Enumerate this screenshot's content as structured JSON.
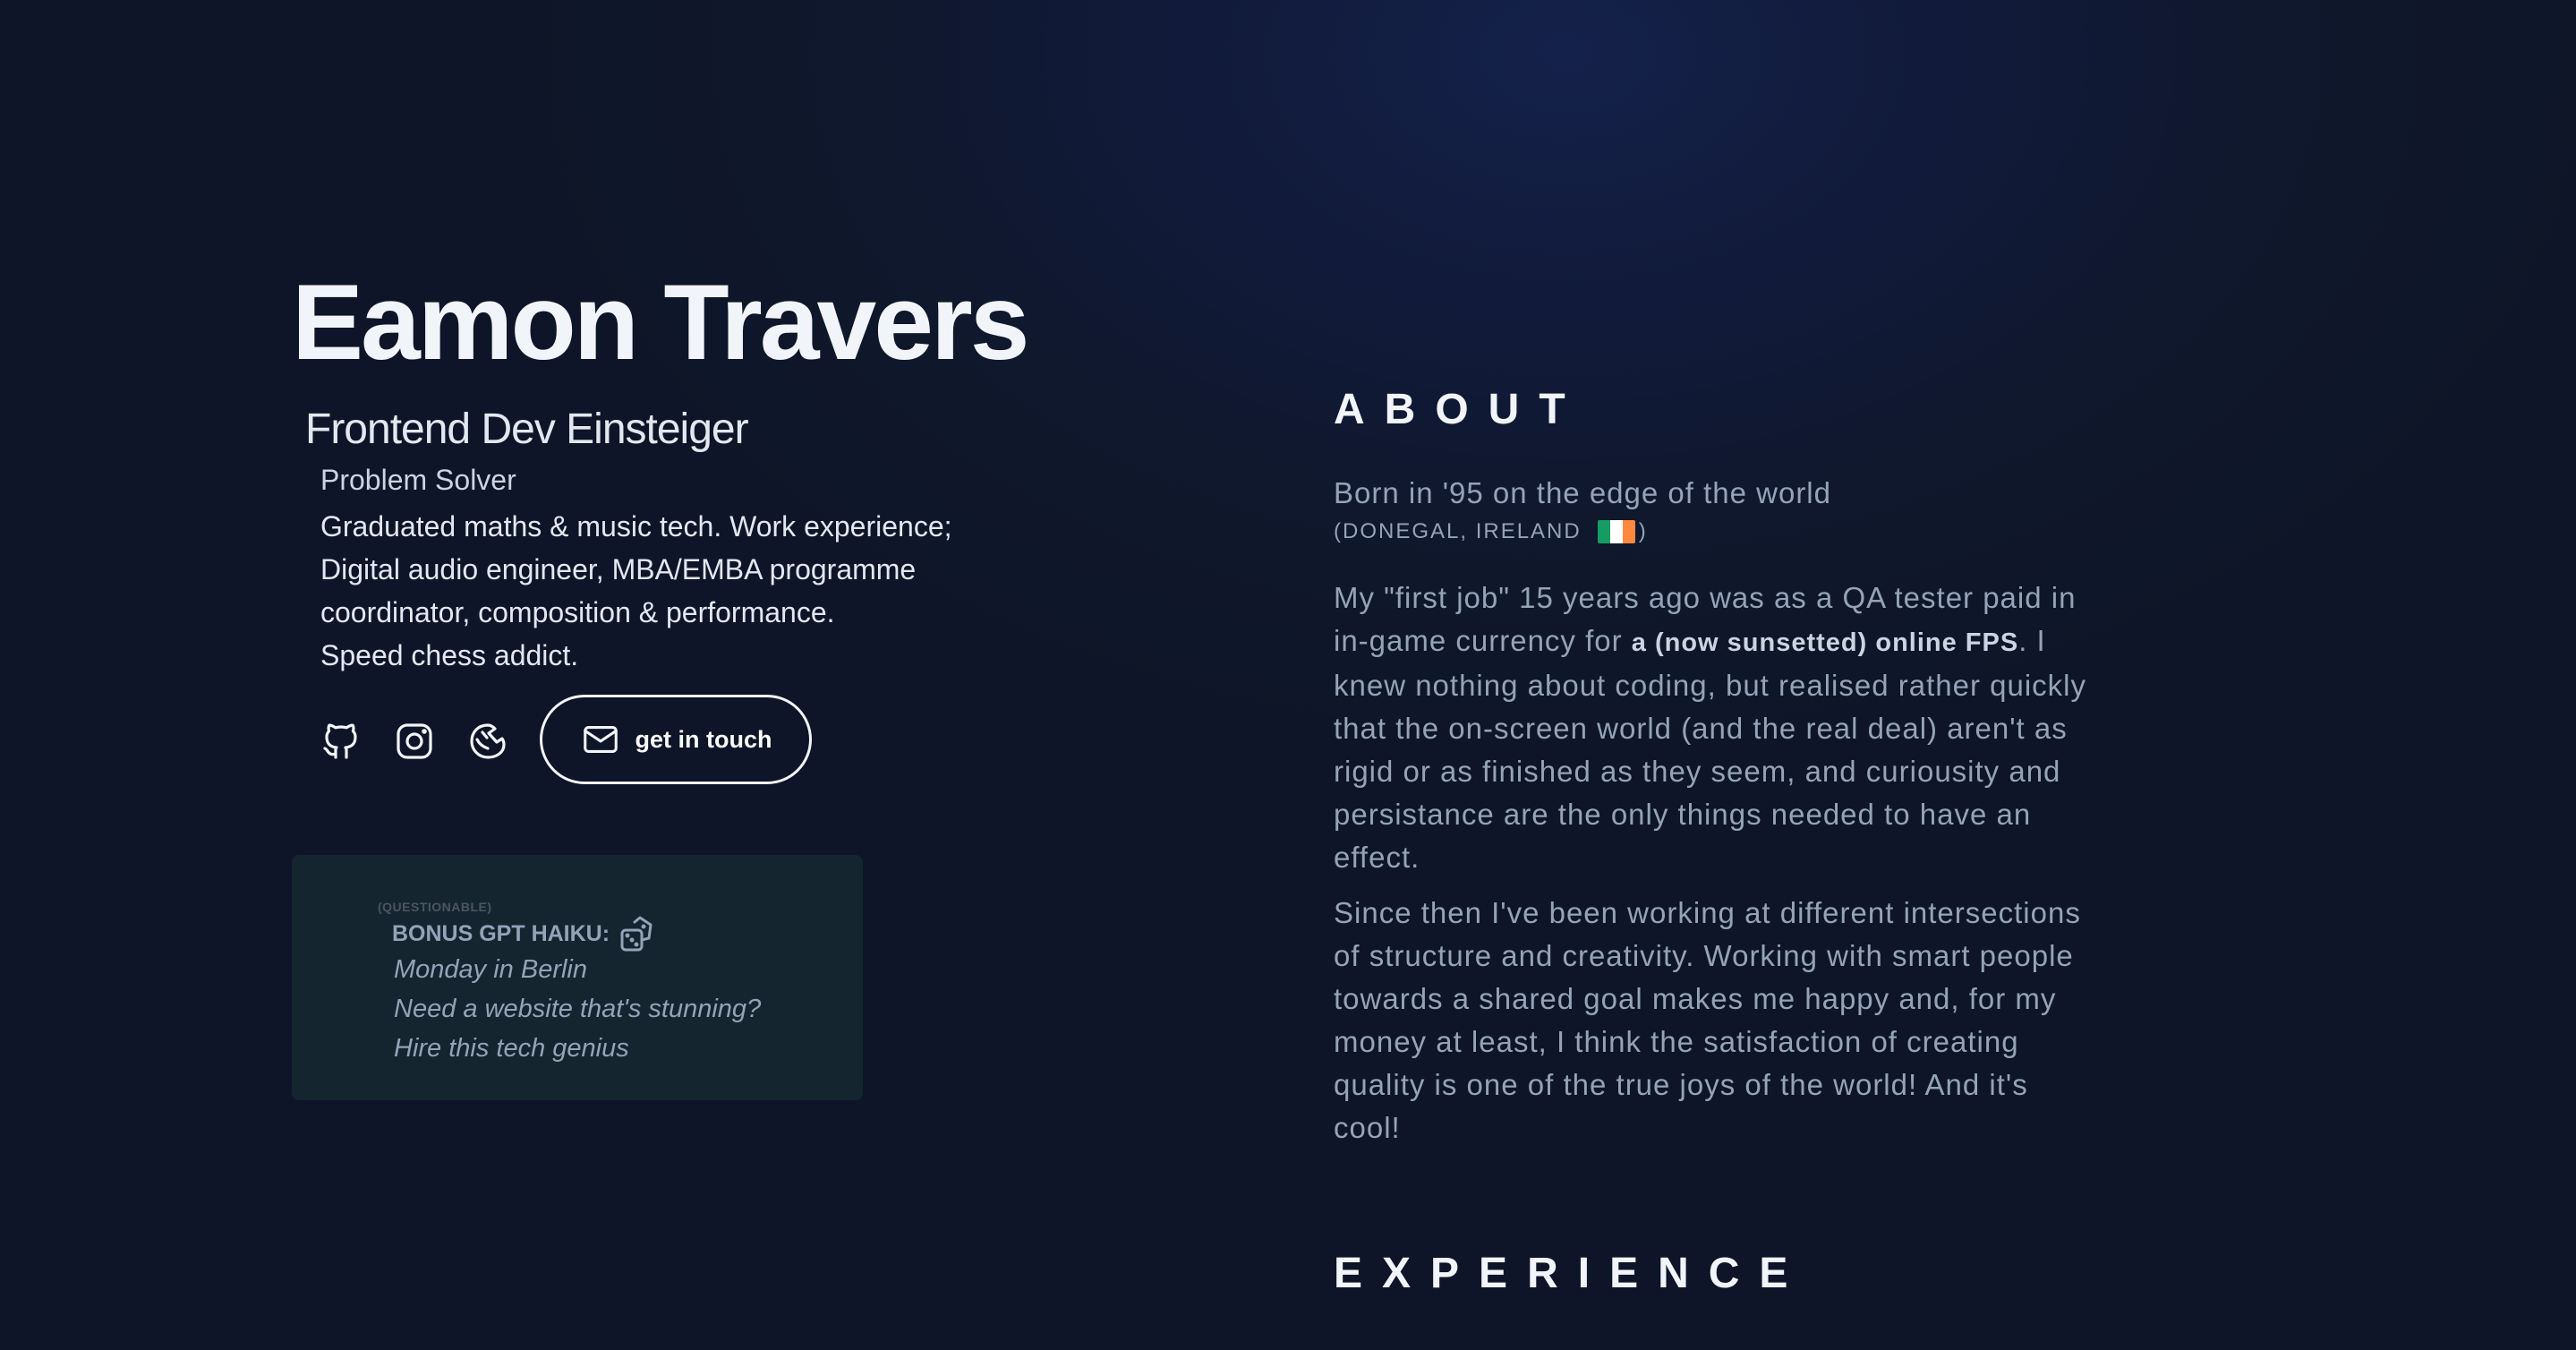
{
  "header": {
    "name": "Eamon Travers",
    "role": "Frontend Dev Einsteiger",
    "subrole": "Problem Solver",
    "bio_lines": [
      "Graduated maths & music tech. Work experience;",
      "Digital audio engineer, MBA/EMBA programme",
      "coordinator, composition & performance.",
      "Speed chess addict."
    ]
  },
  "socials": {
    "icons": [
      "github-icon",
      "instagram-icon",
      "lichess-icon"
    ],
    "contact_label": "get in touch",
    "contact_icon": "mail-icon"
  },
  "haiku": {
    "qualifier": "(QUESTIONABLE)",
    "title": "BONUS GPT HAIKU:",
    "icon": "dice-icon",
    "lines": [
      "Monday in Berlin",
      "Need a website that's stunning?",
      "Hire this tech genius"
    ]
  },
  "about": {
    "heading": "ABOUT",
    "born": "Born in '95 on the edge of the world",
    "location_open": "(DONEGAL, IRELAND",
    "location_close": ")",
    "flag_colors": [
      "#169b62",
      "#ffffff",
      "#ff883e"
    ],
    "p1": {
      "line1": "My \"first job\" 15 years ago was as a QA tester paid in",
      "line2_pre": "in-game currency for ",
      "line2_bold": "a (now sunsetted) online FPS",
      "line2_post": ". I",
      "lines_rest": [
        "knew nothing about coding, but realised rather quickly",
        "that the on-screen world (and the real deal) aren't as",
        "rigid or as finished as they seem, and curiousity and",
        "persistance are the only things needed to have an",
        "effect."
      ]
    },
    "p2_lines": [
      "Since then I've been working at different intersections",
      "of structure and creativity. Working with smart people",
      "towards a shared goal makes me happy and, for my",
      "money at least, I think the satisfaction of creating",
      "quality is one of the true joys of the world! And it's",
      "cool!"
    ]
  },
  "experience": {
    "heading": "EXPERIENCE"
  },
  "colors": {
    "background": "#0f172a",
    "heading": "#f1f5f9",
    "body_text": "#94a3b8",
    "card": "#15252f"
  }
}
